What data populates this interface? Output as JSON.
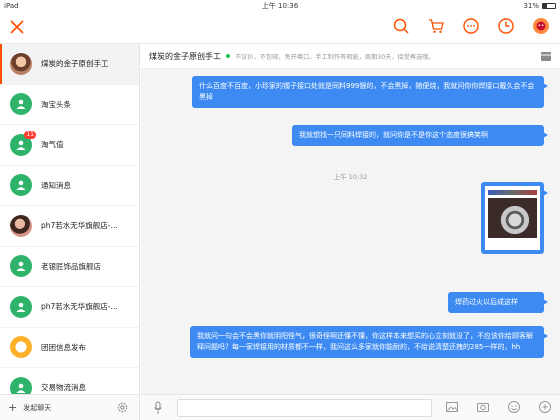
{
  "status": {
    "device": "iPad",
    "wifi": "wifi",
    "time": "上午 10:36",
    "battery": "31%"
  },
  "colors": {
    "accent": "#ff5000",
    "bubble": "#3d8bf2",
    "online": "#27c24c",
    "contact_green": "#2fb36b"
  },
  "topbar": {
    "close_icon": "close-icon",
    "icons": [
      "search-icon",
      "cart-icon",
      "message-icon",
      "history-icon",
      "profile-icon"
    ]
  },
  "sidebar": {
    "items": [
      {
        "name": "煤炭的金子原创手工",
        "avatar": "photo"
      },
      {
        "name": "淘宝头条",
        "avatar": "green"
      },
      {
        "name": "淘气值",
        "avatar": "green",
        "badge": "11"
      },
      {
        "name": "通知消息",
        "avatar": "green"
      },
      {
        "name": "ph7若水无华旗舰店-…",
        "avatar": "photo2"
      },
      {
        "name": "老银匠饰品旗舰店",
        "avatar": "green"
      },
      {
        "name": "ph7若水无华旗舰店-…",
        "avatar": "green"
      },
      {
        "name": "团团信息发布",
        "avatar": "orange"
      },
      {
        "name": "交易物流消息",
        "avatar": "green"
      }
    ],
    "footer_label": "发起聊天",
    "footer_plus": "+"
  },
  "chat": {
    "title": "煤炭的金子原创手工",
    "notice": "不议价，不包邮，免开尊口，手工制作有瑕疵，周期30天，接受再选哦。",
    "messages": [
      "什么百度不百度，小珍家的镯子接口处就是同料999银的，不会黑掉，随便烧，我就问你你焊接口戴久会不会黑掉",
      "我就想找一只同料焊接的，就问你是不是你这个态度很搞笑啊",
      "焊药过火以后成这样",
      "我就问一句会不会黑你就阴阳怪气，很奇怪啊还懂不懂，你这样本来想买的心立刻就没了，不应该你给顾客解释问题吗？每一家焊接用的材质都不一样，我问这么多家就你能耐的，不给说清楚还拽的285一样的，hh"
    ],
    "timestamp": "上午 10:32",
    "input_placeholder": ""
  }
}
